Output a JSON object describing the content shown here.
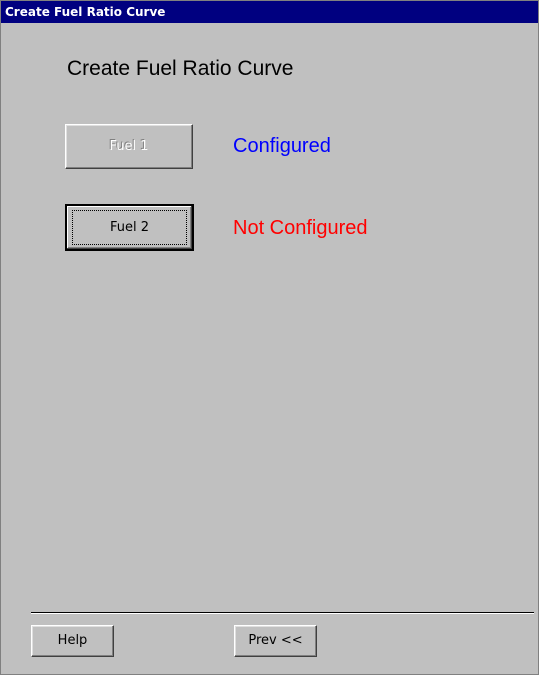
{
  "window": {
    "title": "Create Fuel Ratio Curve"
  },
  "main": {
    "heading": "Create Fuel Ratio Curve",
    "fuels": [
      {
        "button_label": "Fuel 1",
        "status": "Configured",
        "status_color": "#0000ff",
        "enabled": false
      },
      {
        "button_label": "Fuel 2",
        "status": "Not Configured",
        "status_color": "#ff0000",
        "enabled": true
      }
    ]
  },
  "footer": {
    "help_label": "Help",
    "prev_label": "Prev <<"
  },
  "colors": {
    "titlebar": "#000080",
    "face": "#c0c0c0"
  }
}
